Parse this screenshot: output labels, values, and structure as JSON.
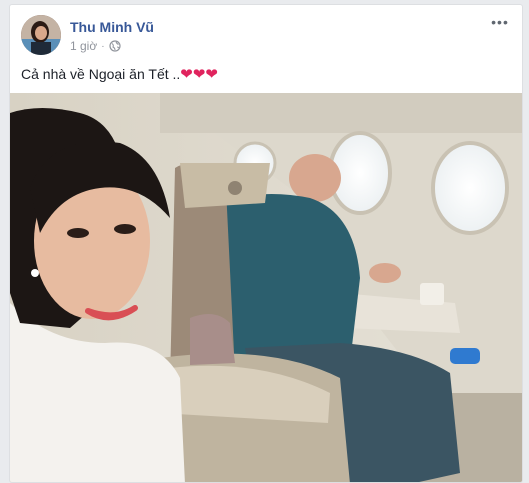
{
  "post": {
    "author_name": "Thu Minh Vũ",
    "timestamp": "1 giờ",
    "separator": "·",
    "privacy_icon": "globe-icon",
    "more_icon": "more-options-icon",
    "more_label": "•••",
    "message_text": "Cả nhà về Ngoại ăn Tết ..",
    "message_emoji": "❤❤❤",
    "photo_icon": "airplane-selfie-photo"
  },
  "colors": {
    "author_link": "#385898",
    "meta_text": "#90949c",
    "heart": "#e0245e",
    "card_border": "#dddfe2",
    "background": "#e9ebee"
  }
}
